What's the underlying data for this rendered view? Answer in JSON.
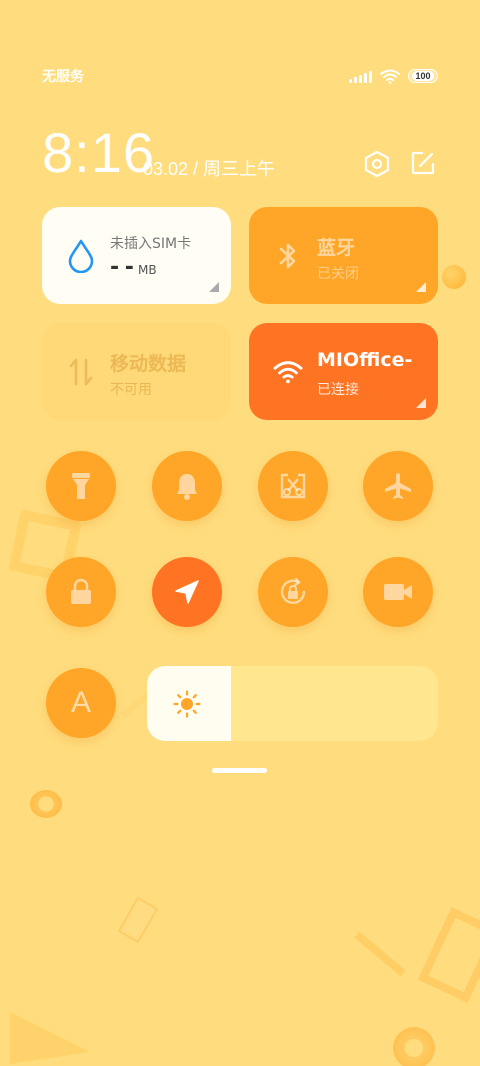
{
  "status_bar": {
    "carrier": "无服务",
    "battery": "100",
    "icons": [
      "signal-icon",
      "wifi-icon",
      "battery-icon"
    ]
  },
  "clock": {
    "time": "8:16",
    "date": "03.02 / 周三上午"
  },
  "header_actions": [
    "settings-icon",
    "edit-icon"
  ],
  "tiles": {
    "data": {
      "title": "未插入SIM卡",
      "value": "- -",
      "unit": "MB",
      "icon": "water-drop-icon",
      "icon_color": "#2196F3"
    },
    "bluetooth": {
      "title": "蓝牙",
      "subtitle": "已关闭",
      "icon": "bluetooth-icon"
    },
    "mobile_data": {
      "title": "移动数据",
      "subtitle": "不可用",
      "icon": "data-arrows-icon"
    },
    "wifi": {
      "title": "MIOffice-",
      "subtitle": "已连接",
      "icon": "wifi-icon"
    }
  },
  "toggles": [
    {
      "name": "flashlight",
      "icon": "flashlight-icon",
      "active": false
    },
    {
      "name": "ringer",
      "icon": "bell-icon",
      "active": false
    },
    {
      "name": "screenshot",
      "icon": "screenshot-icon",
      "active": false
    },
    {
      "name": "airplane-mode",
      "icon": "airplane-icon",
      "active": false
    },
    {
      "name": "lock-screen",
      "icon": "lock-icon",
      "active": false
    },
    {
      "name": "location",
      "icon": "location-icon",
      "active": true
    },
    {
      "name": "auto-rotate",
      "icon": "rotate-lock-icon",
      "active": false
    },
    {
      "name": "screen-record",
      "icon": "video-camera-icon",
      "active": false
    }
  ],
  "brightness": {
    "auto_label": "A",
    "level": 0.29,
    "icon": "sun-icon"
  },
  "colors": {
    "background": "#FFDD7E",
    "tile_orange": "#FFA628",
    "active_orange": "#FF7422",
    "white_tile": "#FFFDF4"
  }
}
